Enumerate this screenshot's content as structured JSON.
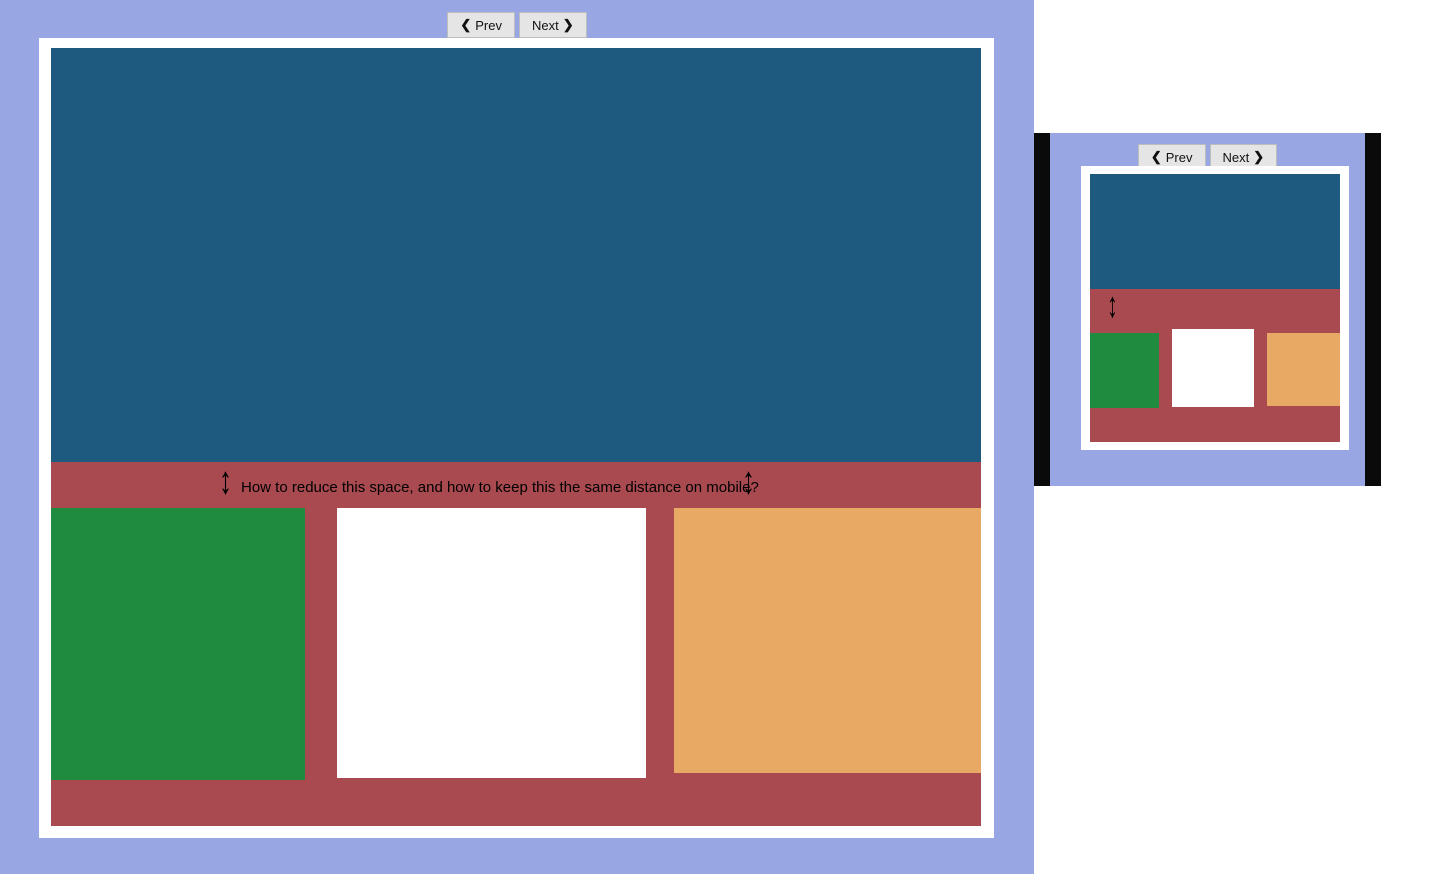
{
  "nav": {
    "prev_label": "Prev",
    "next_label": "Next"
  },
  "annotation": {
    "text": "How to reduce this space, and how to keep this the same distance on mobile?"
  },
  "colors": {
    "frame_bg": "#99a6e4",
    "maroon": "#a84a4f",
    "hero_blue": "#1e5a80",
    "box_green": "#1e8b3f",
    "box_white": "#ffffff",
    "box_tan": "#e7a963"
  }
}
